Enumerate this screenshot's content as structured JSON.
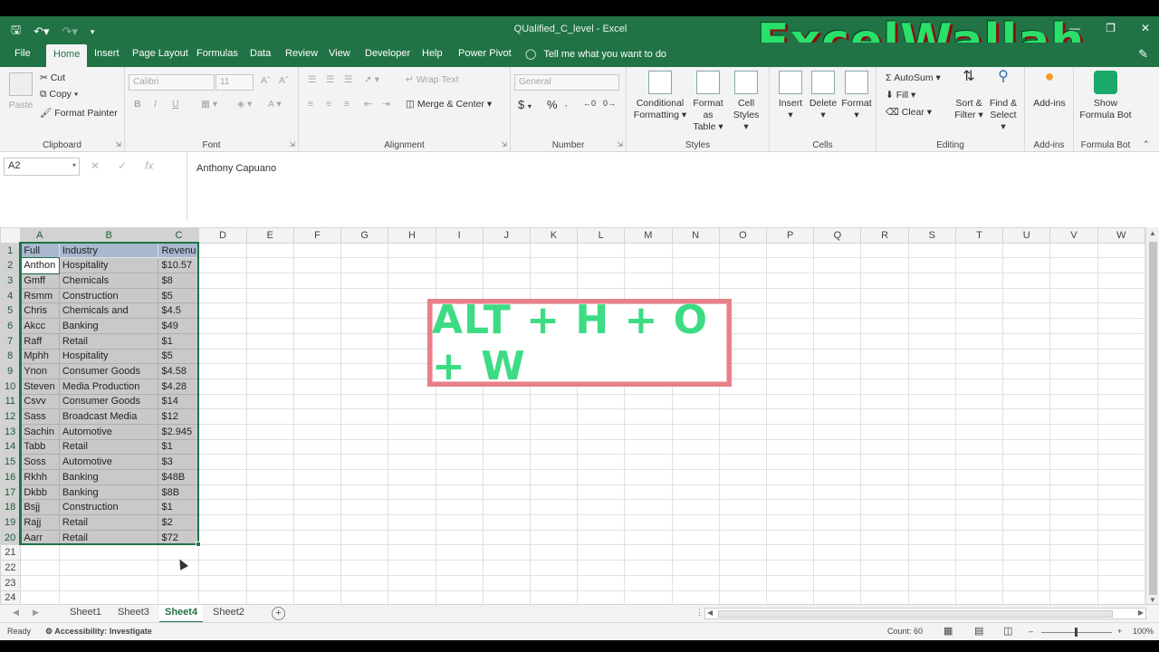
{
  "window": {
    "title": "QUalified_C_level  -  Excel",
    "brand": "ExcelWallah"
  },
  "tabs": [
    "File",
    "Home",
    "Insert",
    "Page Layout",
    "Formulas",
    "Data",
    "Review",
    "View",
    "Developer",
    "Help",
    "Power Pivot"
  ],
  "active_tab": "Home",
  "tell_me": "Tell me what you want to do",
  "ribbon": {
    "clipboard": {
      "paste": "Paste",
      "cut": "Cut",
      "copy": "Copy",
      "format_painter": "Format Painter",
      "label": "Clipboard"
    },
    "font": {
      "name": "Calibri",
      "size": "11",
      "label": "Font",
      "bold": "B",
      "italic": "I",
      "underline": "U"
    },
    "alignment": {
      "wrap_text": "Wrap Text",
      "merge_center": "Merge & Center",
      "label": "Alignment"
    },
    "number": {
      "format": "General",
      "currency": "$",
      "percent": "%",
      "label": "Number"
    },
    "styles": {
      "conditional_formatting_l1": "Conditional",
      "conditional_formatting_l2": "Formatting",
      "format_as_table_l1": "Format as",
      "format_as_table_l2": "Table",
      "cell_styles_l1": "Cell",
      "cell_styles_l2": "Styles",
      "label": "Styles"
    },
    "cells": {
      "insert": "Insert",
      "delete": "Delete",
      "format": "Format",
      "label": "Cells"
    },
    "editing": {
      "autosum": "AutoSum",
      "fill": "Fill",
      "clear": "Clear",
      "sort_filter_l1": "Sort &",
      "sort_filter_l2": "Filter",
      "find_select_l1": "Find &",
      "find_select_l2": "Select",
      "label": "Editing"
    },
    "addins": {
      "addins": "Add-ins",
      "label": "Add-ins"
    },
    "formula_bot": {
      "show_l1": "Show",
      "show_l2": "Formula Bot",
      "label": "Formula Bot"
    }
  },
  "formula_bar": {
    "name_box": "A2",
    "content": "Anthony Capuano"
  },
  "columns": [
    "A",
    "B",
    "C",
    "D",
    "E",
    "F",
    "G",
    "H",
    "I",
    "J",
    "K",
    "L",
    "M",
    "N",
    "O",
    "P",
    "Q",
    "R",
    "S",
    "T",
    "U",
    "V",
    "W"
  ],
  "rows": [
    [
      "Full",
      "Industry",
      "Revenu"
    ],
    [
      "Anthon",
      "Hospitality",
      "$10.57"
    ],
    [
      "Gmff",
      "Chemicals",
      "$8"
    ],
    [
      "Rsmm",
      "Construction",
      "$5"
    ],
    [
      "Chris",
      "Chemicals and",
      "$4.5"
    ],
    [
      "Akcc",
      "Banking",
      "$49"
    ],
    [
      "Raff",
      "Retail",
      "$1"
    ],
    [
      "Mphh",
      "Hospitality",
      "$5"
    ],
    [
      "Ynon",
      "Consumer Goods",
      "$4.58"
    ],
    [
      "Steven",
      "Media Production",
      "$4.28"
    ],
    [
      "Csvv",
      "Consumer Goods",
      "$14"
    ],
    [
      "Sass",
      "Broadcast Media",
      "$12"
    ],
    [
      "Sachin",
      "Automotive",
      "$2.945"
    ],
    [
      "Tabb",
      "Retail",
      "$1"
    ],
    [
      "Soss",
      "Automotive",
      "$3"
    ],
    [
      "Rkhh",
      "Banking",
      "$48B"
    ],
    [
      "Dkbb",
      "Banking",
      "$8B"
    ],
    [
      "Bsjj",
      "Construction",
      "$1"
    ],
    [
      "Rajj",
      "Retail",
      "$2"
    ],
    [
      "Aarr",
      "Retail",
      "$72"
    ],
    [
      "",
      "",
      ""
    ],
    [
      "",
      "",
      ""
    ],
    [
      "",
      "",
      ""
    ],
    [
      "",
      "",
      ""
    ],
    [
      "",
      "",
      ""
    ]
  ],
  "shortcut_text": "ALT + H + O + W",
  "sheets": [
    "Sheet1",
    "Sheet3",
    "Sheet4",
    "Sheet2"
  ],
  "active_sheet": "Sheet4",
  "status": {
    "ready": "Ready",
    "accessibility": "Accessibility: Investigate",
    "count": "Count: 60",
    "zoom": "100%"
  },
  "colors": {
    "accent": "#217346",
    "header_fill": "#a9b7cf",
    "selection_fill": "#c9c9c9",
    "shortcut_border": "#e8808a",
    "shortcut_text": "#3ddc84"
  }
}
